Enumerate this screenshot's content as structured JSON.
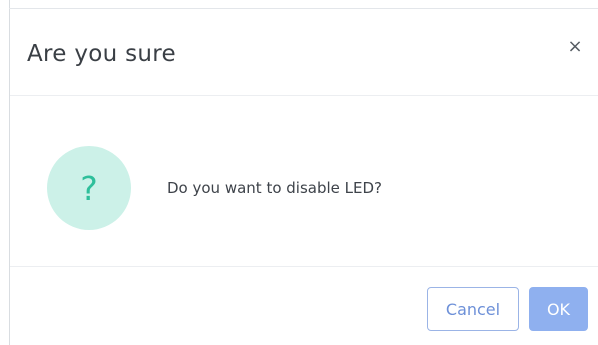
{
  "dialog": {
    "title": "Are you sure",
    "close_glyph": "×",
    "icon": "question-mark-icon",
    "icon_glyph": "?",
    "message": "Do you want to disable LED?",
    "cancel_label": "Cancel",
    "ok_label": "OK"
  },
  "colors": {
    "icon_bg": "#ccf1e8",
    "icon_fg": "#2fbf9b",
    "primary": "#8fb0ef",
    "cancel_border": "#9bb4e6",
    "cancel_text": "#6d90d8"
  }
}
